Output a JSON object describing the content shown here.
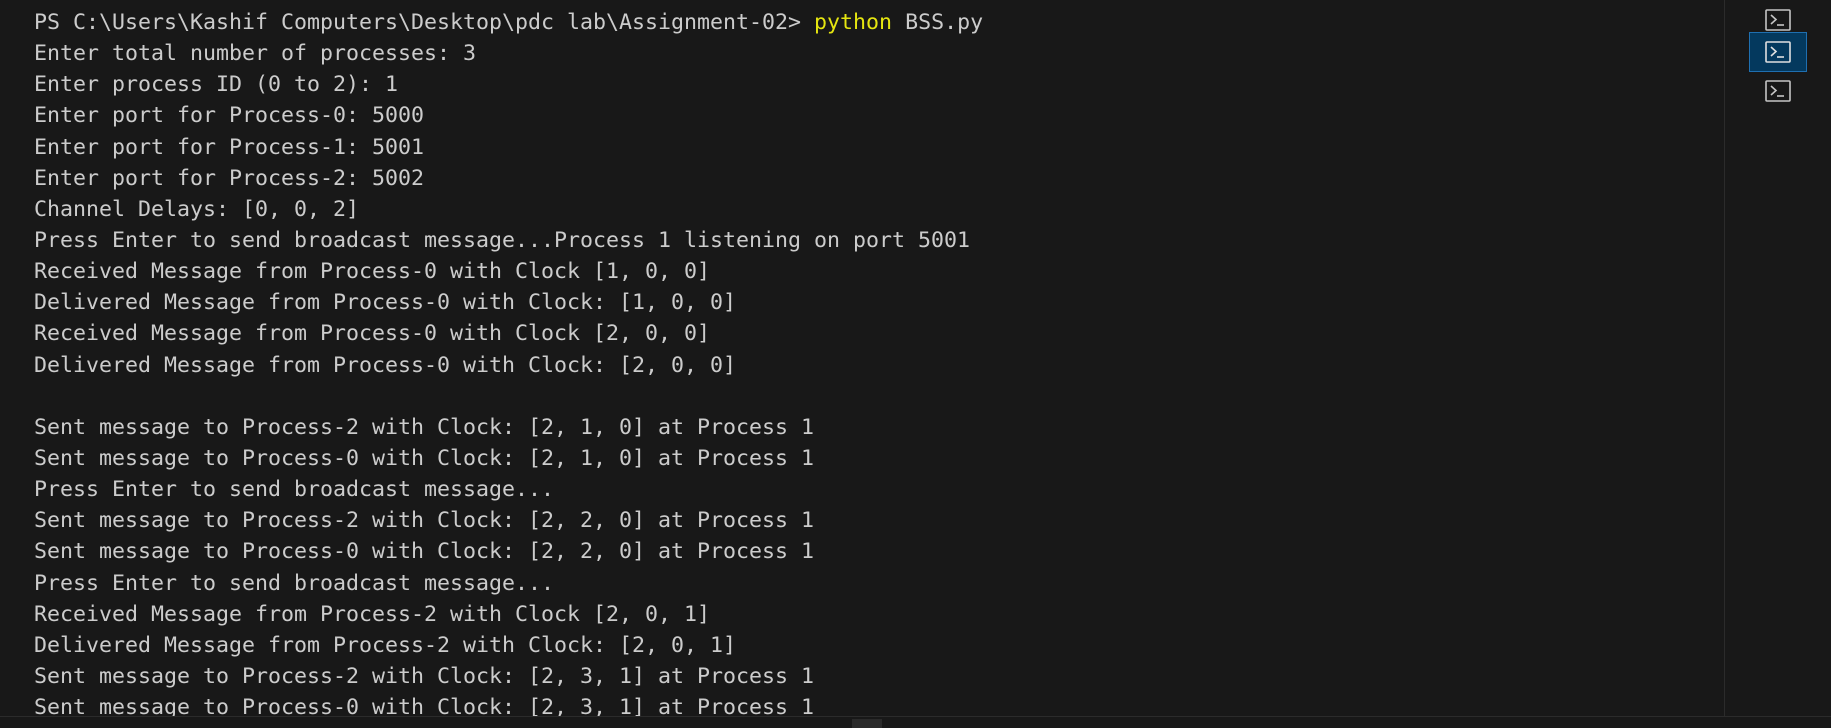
{
  "terminal": {
    "prompt": {
      "path": "PS C:\\Users\\Kashif Computers\\Desktop\\pdc lab\\Assignment-02> ",
      "command": "python",
      "args": " BSS.py"
    },
    "lines": [
      "Enter total number of processes: 3",
      "Enter process ID (0 to 2): 1",
      "Enter port for Process-0: 5000",
      "Enter port for Process-1: 5001",
      "Enter port for Process-2: 5002",
      "Channel Delays: [0, 0, 2]",
      "Press Enter to send broadcast message...Process 1 listening on port 5001",
      "Received Message from Process-0 with Clock [1, 0, 0]",
      "Delivered Message from Process-0 with Clock: [1, 0, 0]",
      "Received Message from Process-0 with Clock [2, 0, 0]",
      "Delivered Message from Process-0 with Clock: [2, 0, 0]",
      "",
      "Sent message to Process-2 with Clock: [2, 1, 0] at Process 1",
      "Sent message to Process-0 with Clock: [2, 1, 0] at Process 1",
      "Press Enter to send broadcast message...",
      "Sent message to Process-2 with Clock: [2, 2, 0] at Process 1",
      "Sent message to Process-0 with Clock: [2, 2, 0] at Process 1",
      "Press Enter to send broadcast message...",
      "Received Message from Process-2 with Clock [2, 0, 1]",
      "Delivered Message from Process-2 with Clock: [2, 0, 1]",
      "Sent message to Process-2 with Clock: [2, 3, 1] at Process 1",
      "Sent message to Process-0 with Clock: [2, 3, 1] at Process 1"
    ]
  },
  "terminal_tabs": [
    {
      "icon": "powershell-terminal-icon",
      "active": false
    },
    {
      "icon": "powershell-terminal-icon",
      "active": true
    },
    {
      "icon": "powershell-terminal-icon",
      "active": false
    }
  ],
  "colors": {
    "background": "#181818",
    "text": "#cccccc",
    "command_highlight": "#e5e510",
    "active_tab": "#04395e",
    "active_tab_border": "#1f6fb0"
  }
}
